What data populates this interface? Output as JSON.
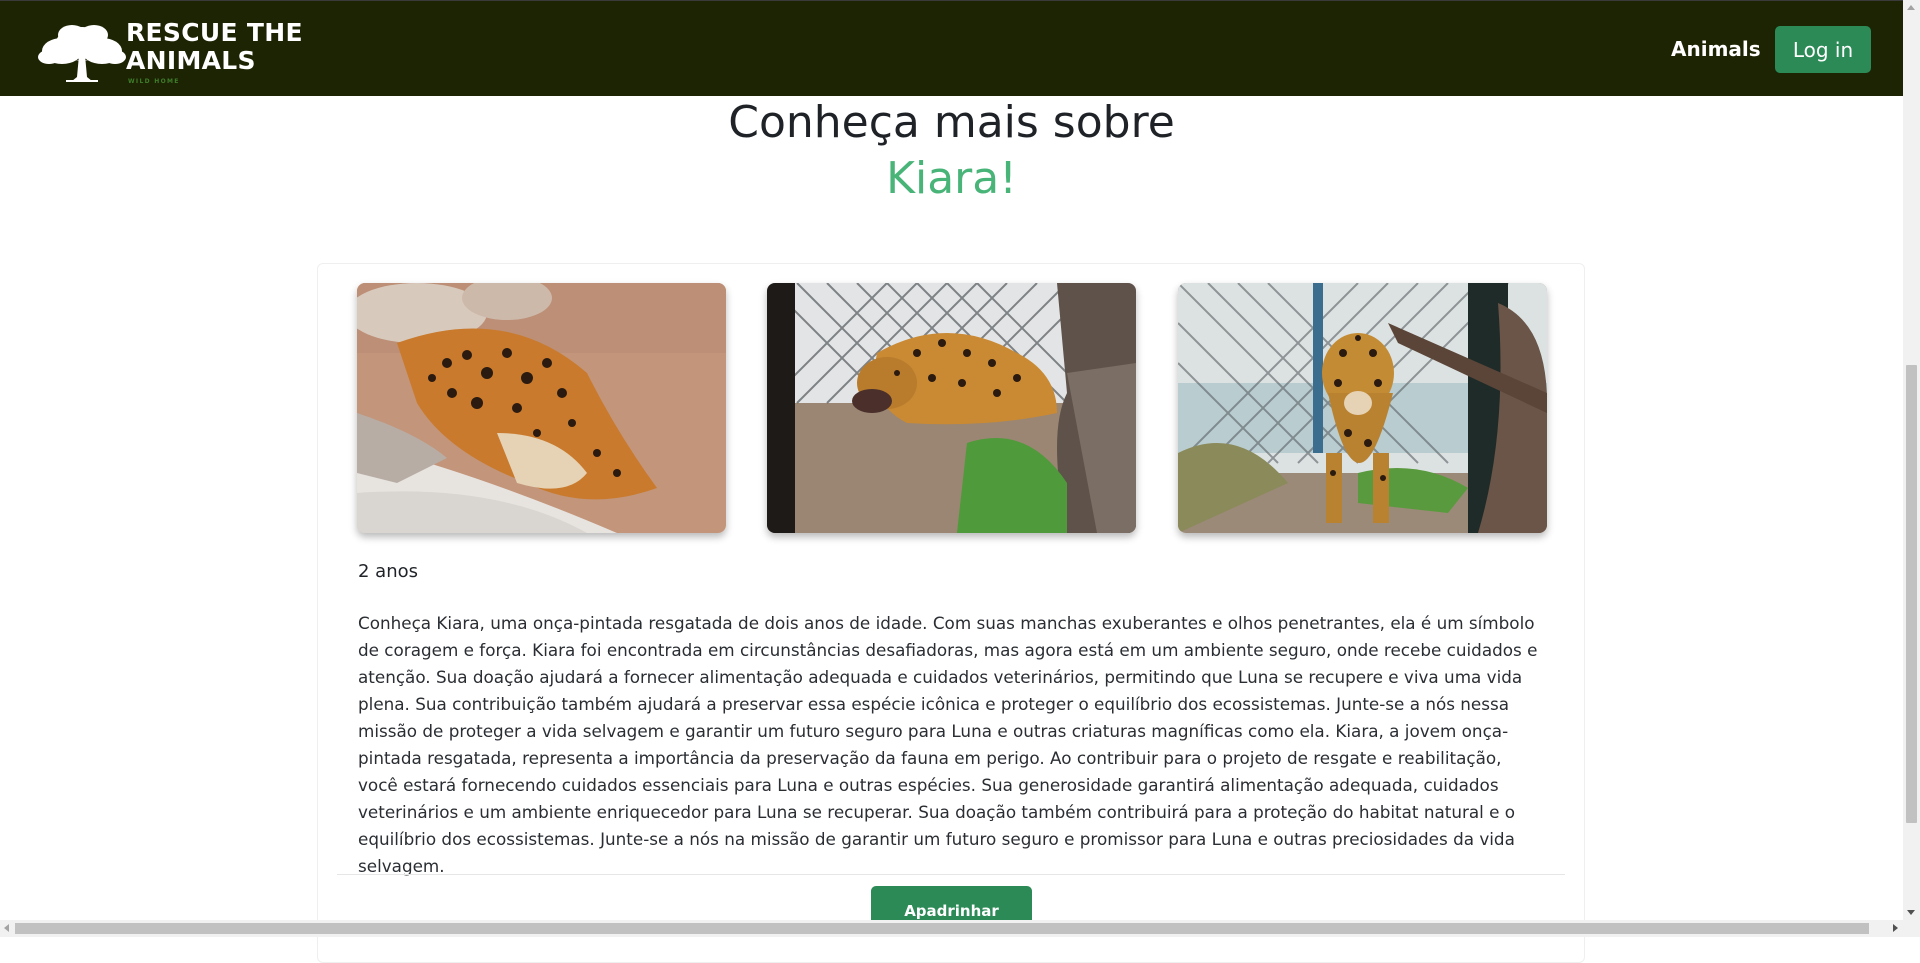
{
  "navbar": {
    "brand_line1": "RESCUE THE",
    "brand_line2": "ANIMALS",
    "brand_tagline": "WILD HOME",
    "animals_link": "Animals",
    "login_label": "Log in"
  },
  "heading": {
    "line1": "Conheça mais sobre",
    "animal_name": "Kiara!"
  },
  "animal": {
    "age": "2 anos",
    "description": "Conheça Kiara, uma onça-pintada resgatada de dois anos de idade. Com suas manchas exuberantes e olhos penetrantes, ela é um símbolo de coragem e força. Kiara foi encontrada em circunstâncias desafiadoras, mas agora está em um ambiente seguro, onde recebe cuidados e atenção. Sua doação ajudará a fornecer alimentação adequada e cuidados veterinários, permitindo que Luna se recupere e viva uma vida plena. Sua contribuição também ajudará a preservar essa espécie icônica e proteger o equilíbrio dos ecossistemas. Junte-se a nós nessa missão de proteger a vida selvagem e garantir um futuro seguro para Luna e outras criaturas magníficas como ela. Kiara, a jovem onça-pintada resgatada, representa a importância da preservação da fauna em perigo. Ao contribuir para o projeto de resgate e reabilitação, você estará fornecendo cuidados essenciais para Luna e outras espécies. Sua generosidade garantirá alimentação adequada, cuidados veterinários e um ambiente enriquecedor para Luna se recuperar. Sua doação também contribuirá para a proteção do habitat natural e o equilíbrio dos ecossistemas. Junte-se a nós na missão de garantir um futuro seguro e promissor para Luna e outras preciosidades da vida selvagem.",
    "photos": [
      "jaguar-resting-on-rock",
      "jaguar-eating-behind-fence",
      "jaguar-walking-toward-camera"
    ]
  },
  "actions": {
    "adopt_label": "Apadrinhar"
  },
  "colors": {
    "navbar_bg": "#1c2404",
    "accent_green": "#2b8a56",
    "name_green": "#48b478"
  }
}
